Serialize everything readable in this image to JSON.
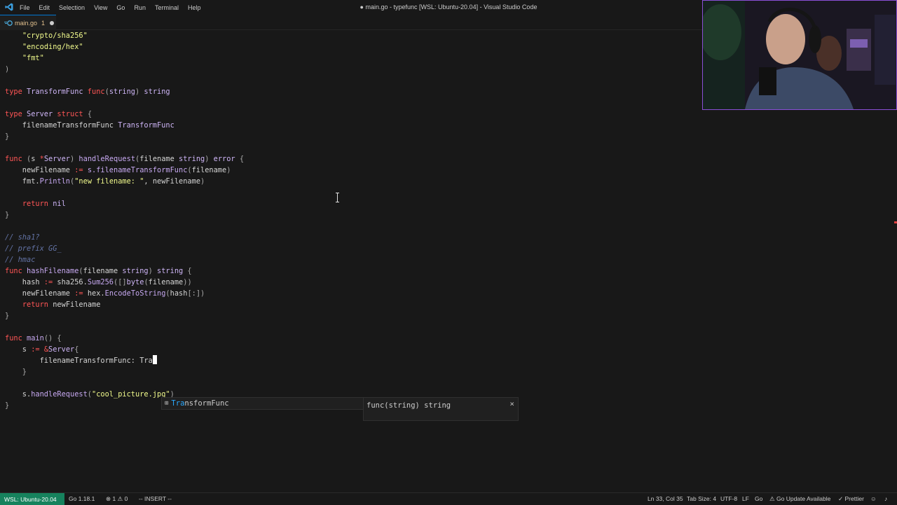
{
  "menu": [
    "File",
    "Edit",
    "Selection",
    "View",
    "Go",
    "Run",
    "Terminal",
    "Help"
  ],
  "window_title": "● main.go - typefunc [WSL: Ubuntu-20.04] - Visual Studio Code",
  "tab": {
    "name": "main.go",
    "problems": "1"
  },
  "code_lines": [
    [
      [
        "    ",
        "pr"
      ],
      [
        "\"",
        "st"
      ],
      [
        "crypto/sha256",
        "st"
      ],
      [
        "\"",
        "st"
      ]
    ],
    [
      [
        "    ",
        "pr"
      ],
      [
        "\"",
        "st"
      ],
      [
        "encoding/hex",
        "st"
      ],
      [
        "\"",
        "st"
      ]
    ],
    [
      [
        "    ",
        "pr"
      ],
      [
        "\"",
        "st"
      ],
      [
        "fmt",
        "st"
      ],
      [
        "\"",
        "st"
      ]
    ],
    [
      [
        ")",
        "pr"
      ]
    ],
    [
      [
        "",
        "pr"
      ]
    ],
    [
      [
        "type ",
        "kw"
      ],
      [
        "TransformFunc ",
        "tp"
      ],
      [
        "func",
        "kw"
      ],
      [
        "(",
        "pr"
      ],
      [
        "string",
        "tp"
      ],
      [
        ") ",
        "pr"
      ],
      [
        "string",
        "tp"
      ]
    ],
    [
      [
        "",
        "pr"
      ]
    ],
    [
      [
        "type ",
        "kw"
      ],
      [
        "Server ",
        "tp"
      ],
      [
        "struct ",
        "kw"
      ],
      [
        "{",
        "pr"
      ]
    ],
    [
      [
        "    filenameTransformFunc ",
        "vr"
      ],
      [
        "TransformFunc",
        "tp"
      ]
    ],
    [
      [
        "}",
        "pr"
      ]
    ],
    [
      [
        "",
        "pr"
      ]
    ],
    [
      [
        "func ",
        "kw"
      ],
      [
        "(",
        "pr"
      ],
      [
        "s ",
        "vr"
      ],
      [
        "*",
        "kw"
      ],
      [
        "Server",
        "tp"
      ],
      [
        ") ",
        "pr"
      ],
      [
        "handleRequest",
        "fn"
      ],
      [
        "(",
        "pr"
      ],
      [
        "filename ",
        "vr"
      ],
      [
        "string",
        "tp"
      ],
      [
        ") ",
        "pr"
      ],
      [
        "error ",
        "tp"
      ],
      [
        "{",
        "pr"
      ]
    ],
    [
      [
        "    newFilename ",
        "vr"
      ],
      [
        ":= ",
        "kw"
      ],
      [
        "s.filenameTransformFunc",
        "fn"
      ],
      [
        "(",
        "pr"
      ],
      [
        "filename",
        "vr"
      ],
      [
        ")",
        "pr"
      ]
    ],
    [
      [
        "    fmt.",
        "vr"
      ],
      [
        "Println",
        "fn"
      ],
      [
        "(",
        "pr"
      ],
      [
        "\"new filename: \"",
        "st"
      ],
      [
        ", newFilename",
        "vr"
      ],
      [
        ")",
        "pr"
      ]
    ],
    [
      [
        "",
        "pr"
      ]
    ],
    [
      [
        "    ",
        "pr"
      ],
      [
        "return ",
        "kw"
      ],
      [
        "nil",
        "tp"
      ]
    ],
    [
      [
        "}",
        "pr"
      ]
    ],
    [
      [
        "",
        "pr"
      ]
    ],
    [
      [
        "// sha1?",
        "cm"
      ]
    ],
    [
      [
        "// prefix GG_",
        "cm"
      ]
    ],
    [
      [
        "// hmac",
        "cm"
      ]
    ],
    [
      [
        "func ",
        "kw"
      ],
      [
        "hashFilename",
        "fn"
      ],
      [
        "(",
        "pr"
      ],
      [
        "filename ",
        "vr"
      ],
      [
        "string",
        "tp"
      ],
      [
        ") ",
        "pr"
      ],
      [
        "string ",
        "tp"
      ],
      [
        "{",
        "pr"
      ]
    ],
    [
      [
        "    hash ",
        "vr"
      ],
      [
        ":= ",
        "kw"
      ],
      [
        "sha256.",
        "vr"
      ],
      [
        "Sum256",
        "fn"
      ],
      [
        "(",
        "pr"
      ],
      [
        "[]",
        "pr"
      ],
      [
        "byte",
        "tp"
      ],
      [
        "(",
        "pr"
      ],
      [
        "filename",
        "vr"
      ],
      [
        "))",
        "pr"
      ]
    ],
    [
      [
        "    newFilename ",
        "vr"
      ],
      [
        ":= ",
        "kw"
      ],
      [
        "hex.",
        "vr"
      ],
      [
        "EncodeToString",
        "fn"
      ],
      [
        "(",
        "pr"
      ],
      [
        "hash",
        "vr"
      ],
      [
        "[:]",
        "pr"
      ],
      [
        ")",
        "pr"
      ]
    ],
    [
      [
        "    ",
        "pr"
      ],
      [
        "return ",
        "kw"
      ],
      [
        "newFilename",
        "vr"
      ]
    ],
    [
      [
        "}",
        "pr"
      ]
    ],
    [
      [
        "",
        "pr"
      ]
    ],
    [
      [
        "func ",
        "kw"
      ],
      [
        "main",
        "fn"
      ],
      [
        "() ",
        "pr"
      ],
      [
        "{",
        "pr"
      ]
    ],
    [
      [
        "    s ",
        "vr"
      ],
      [
        ":= ",
        "kw"
      ],
      [
        "&",
        "kw"
      ],
      [
        "Server",
        "tp"
      ],
      [
        "{",
        "pr"
      ]
    ],
    [
      [
        "        filenameTransformFunc: ",
        "vr"
      ],
      [
        "Tra",
        "vr"
      ],
      [
        "",
        "cursor"
      ]
    ],
    [
      [
        "    }",
        "pr"
      ]
    ],
    [
      [
        "",
        "pr"
      ]
    ],
    [
      [
        "    s.",
        "vr"
      ],
      [
        "handleRequest",
        "fn"
      ],
      [
        "(",
        "pr"
      ],
      [
        "\"cool_picture.jpg\"",
        "st"
      ],
      [
        ")",
        "pr"
      ]
    ],
    [
      [
        "}",
        "pr"
      ]
    ]
  ],
  "suggestion": {
    "match": "Tra",
    "rest": "nsformFunc",
    "kind_icon": "type-icon",
    "detail": "func(string) string",
    "close": "×"
  },
  "status": {
    "remote": "WSL: Ubuntu-20.04",
    "go_version": "Go 1.18.1",
    "errors": "1",
    "warnings": "0",
    "mode": "-- INSERT --",
    "position": "Ln 33, Col 35",
    "tab_size": "Tab Size: 4",
    "encoding": "UTF-8",
    "eol": "LF",
    "language": "Go",
    "go_update": "Go Update Available",
    "formatter": "Prettier"
  },
  "colors": {
    "accent": "#0078d4",
    "remote_bg": "#16825d",
    "webcam_border": "#8a4fd6"
  }
}
